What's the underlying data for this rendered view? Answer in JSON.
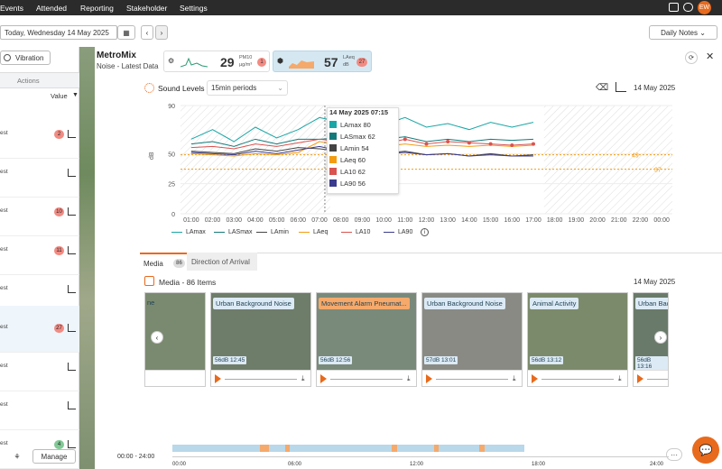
{
  "nav": {
    "items": [
      "Events",
      "Attended",
      "Reporting",
      "Stakeholder",
      "Settings"
    ],
    "avatar": "EW"
  },
  "datebar": {
    "date": "Today, Wednesday 14 May 2025",
    "view": "Daily Notes"
  },
  "left": {
    "filter": "Vibration",
    "col_actions": "Actions",
    "col_value": "Value",
    "rows": [
      {
        "label": "est",
        "badge": "2",
        "badge_color": "#f28b82"
      },
      {
        "label": "est",
        "badge": "",
        "badge_color": ""
      },
      {
        "label": "est",
        "badge": "10",
        "badge_color": "#f28b82"
      },
      {
        "label": "est",
        "badge": "11",
        "badge_color": "#f28b82"
      },
      {
        "label": "est",
        "badge": "",
        "badge_color": ""
      },
      {
        "label": "est",
        "badge": "27",
        "badge_color": "#f28b82"
      },
      {
        "label": "est",
        "badge": "",
        "badge_color": ""
      },
      {
        "label": "est",
        "badge": "",
        "badge_color": ""
      },
      {
        "label": "est",
        "badge": "4",
        "badge_color": "#81c995"
      }
    ],
    "manage": "Manage"
  },
  "header": {
    "title": "MetroMix",
    "subtitle": "Noise - Latest Data",
    "tile1_value": "29",
    "tile1_unit_top": "PM10",
    "tile1_unit_bottom": "µg/m³",
    "tile1_badge": "1",
    "tile2_value": "57",
    "tile2_unit_top": "LAeq",
    "tile2_unit_bottom": "dB",
    "tile2_badge": "27"
  },
  "sound": {
    "title": "Sound Levels",
    "period": "15min periods",
    "date": "14 May 2025"
  },
  "tooltip": {
    "time": "14 May 2025 07:15",
    "items": [
      {
        "name": "LAmax",
        "value": "80",
        "color": "#1aa6a6"
      },
      {
        "name": "LASmax",
        "value": "62",
        "color": "#137a7a"
      },
      {
        "name": "LAmin",
        "value": "54",
        "color": "#444444"
      },
      {
        "name": "LAeq",
        "value": "60",
        "color": "#f39c12"
      },
      {
        "name": "LA10",
        "value": "62",
        "color": "#d9534f"
      },
      {
        "name": "LA90",
        "value": "56",
        "color": "#3b3b8f"
      }
    ]
  },
  "chart_data": {
    "type": "line",
    "ylabel": "dB",
    "ylim": [
      0,
      90
    ],
    "yticks": [
      "90",
      "50",
      "25",
      "0"
    ],
    "x": [
      "01:00",
      "02:00",
      "03:00",
      "04:00",
      "05:00",
      "06:00",
      "07:00",
      "08:00",
      "09:00",
      "10:00",
      "11:00",
      "12:00",
      "13:00",
      "14:00",
      "15:00",
      "16:00",
      "17:00",
      "18:00",
      "19:00",
      "20:00",
      "21:00",
      "22:00",
      "00:00"
    ],
    "series": [
      {
        "name": "LAmax",
        "color": "#1aa6a6",
        "values": [
          62,
          70,
          60,
          72,
          63,
          70,
          80,
          76,
          78,
          74,
          80,
          72,
          75,
          70,
          76,
          72,
          76
        ]
      },
      {
        "name": "LASmax",
        "color": "#137a7a",
        "values": [
          58,
          60,
          56,
          62,
          58,
          62,
          62,
          63,
          64,
          62,
          64,
          60,
          62,
          60,
          62,
          61,
          62
        ]
      },
      {
        "name": "LAmin",
        "color": "#444444",
        "values": [
          52,
          51,
          50,
          54,
          52,
          55,
          54,
          52,
          53,
          50,
          52,
          49,
          50,
          48,
          50,
          48,
          49
        ]
      },
      {
        "name": "LAeq",
        "color": "#f39c12",
        "values": [
          50,
          49,
          48,
          50,
          49,
          51,
          60,
          57,
          58,
          56,
          58,
          56,
          57,
          56,
          57,
          56,
          57
        ]
      },
      {
        "name": "LA10",
        "color": "#d9534f",
        "values": [
          55,
          56,
          54,
          58,
          56,
          59,
          62,
          60,
          61,
          58,
          62,
          58,
          60,
          59,
          58,
          57,
          58
        ]
      },
      {
        "name": "LA90",
        "color": "#3b3b8f",
        "values": [
          51,
          50,
          49,
          52,
          50,
          53,
          56,
          52,
          52,
          50,
          51,
          49,
          50,
          48,
          49,
          48,
          48
        ]
      }
    ],
    "thresholds": [
      {
        "value": "49",
        "color": "#f39c12"
      },
      {
        "value": "37",
        "color": "#f39c12"
      }
    ],
    "legend": [
      "LAmax",
      "LASmax",
      "LAmin",
      "LAeq",
      "LA10",
      "LA90"
    ]
  },
  "tabs": {
    "media": "Media",
    "media_count": "86",
    "direction": "Direction of Arrival"
  },
  "media": {
    "title": "Media - 86 Items",
    "date": "14 May 2025",
    "cards": [
      {
        "tag": "Urban Background Noise",
        "stamp": "56dB 12:45",
        "tag_color": "#dceaf5"
      },
      {
        "tag": "Movement Alarm Pneumat...",
        "stamp": "56dB 12:56",
        "tag_color": "#f5a96b"
      },
      {
        "tag": "Urban Background Noise",
        "stamp": "57dB 13:01",
        "tag_color": "#dceaf5"
      },
      {
        "tag": "Animal Activity",
        "stamp": "56dB 13:12",
        "tag_color": "#dceaf5"
      },
      {
        "tag": "Urban Bac",
        "stamp": "56dB 13:16",
        "tag_color": "#dceaf5"
      }
    ]
  },
  "timeline": {
    "range": "00:00 - 24:00",
    "ticks": [
      "00:00",
      "06:00",
      "12:00",
      "18:00",
      "24:00"
    ]
  }
}
